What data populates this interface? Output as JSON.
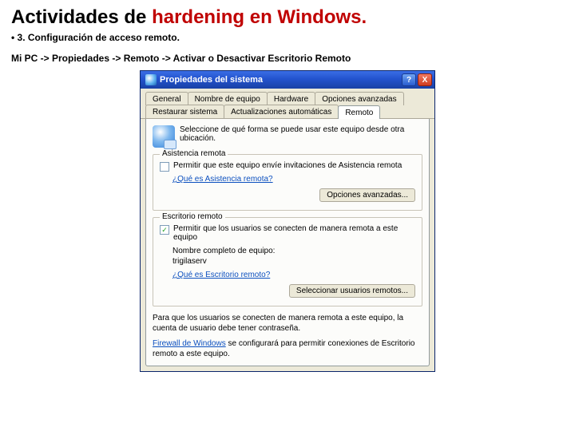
{
  "slide": {
    "title_a": "Actividades de ",
    "title_b": "hardening en Windows",
    "title_dot": ".",
    "bullet": "• 3. Configuración de acceso remoto.",
    "path": "Mi PC -> Propiedades -> Remoto -> Activar o Desactivar Escritorio Remoto"
  },
  "dialog": {
    "title": "Propiedades del sistema",
    "help": "?",
    "close": "X",
    "tabs_row1": [
      "General",
      "Nombre de equipo",
      "Hardware",
      "Opciones avanzadas"
    ],
    "tabs_row2": [
      "Restaurar sistema",
      "Actualizaciones automáticas",
      "Remoto"
    ],
    "intro": "Seleccione de qué forma se puede usar este equipo desde otra ubicación.",
    "group1": {
      "legend": "Asistencia remota",
      "chk_label": "Permitir que este equipo envíe invitaciones de Asistencia remota",
      "link": "¿Qué es Asistencia remota?",
      "adv_btn": "Opciones avanzadas..."
    },
    "group2": {
      "legend": "Escritorio remoto",
      "chk_label": "Permitir que los usuarios se conecten de manera remota a este equipo",
      "fullname_label": "Nombre completo de equipo:",
      "fullname_value": "trigilaserv",
      "link": "¿Qué es Escritorio remoto?",
      "select_btn": "Seleccionar usuarios remotos..."
    },
    "note1": "Para que los usuarios se conecten de manera remota a este equipo, la cuenta de usuario debe tener contraseña.",
    "note2a": "Firewall de Windows",
    "note2b": " se configurará para permitir conexiones de Escritorio remoto a este equipo."
  }
}
